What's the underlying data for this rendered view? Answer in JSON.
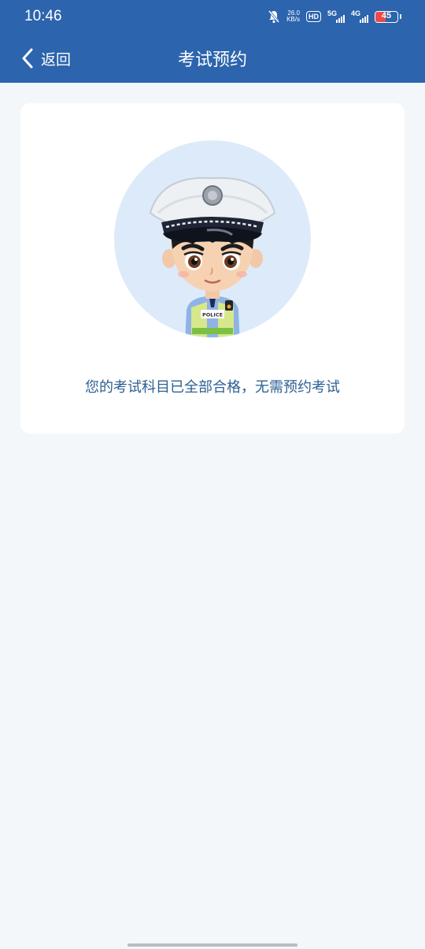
{
  "status_bar": {
    "time": "10:46",
    "net_speed_value": "26.0",
    "net_speed_unit": "KB/s",
    "hd_label": "HD",
    "sim1_network": "5G",
    "sim2_network": "4G",
    "battery_level": "45",
    "battery_color": "#e94b4b"
  },
  "header": {
    "back_label": "返回",
    "title": "考试预约",
    "background": "#2c64ad"
  },
  "main": {
    "illustration": "traffic-police-cartoon",
    "illustration_badge_text": "POLICE",
    "message": "您的考试科目已全部合格，无需预约考试"
  }
}
